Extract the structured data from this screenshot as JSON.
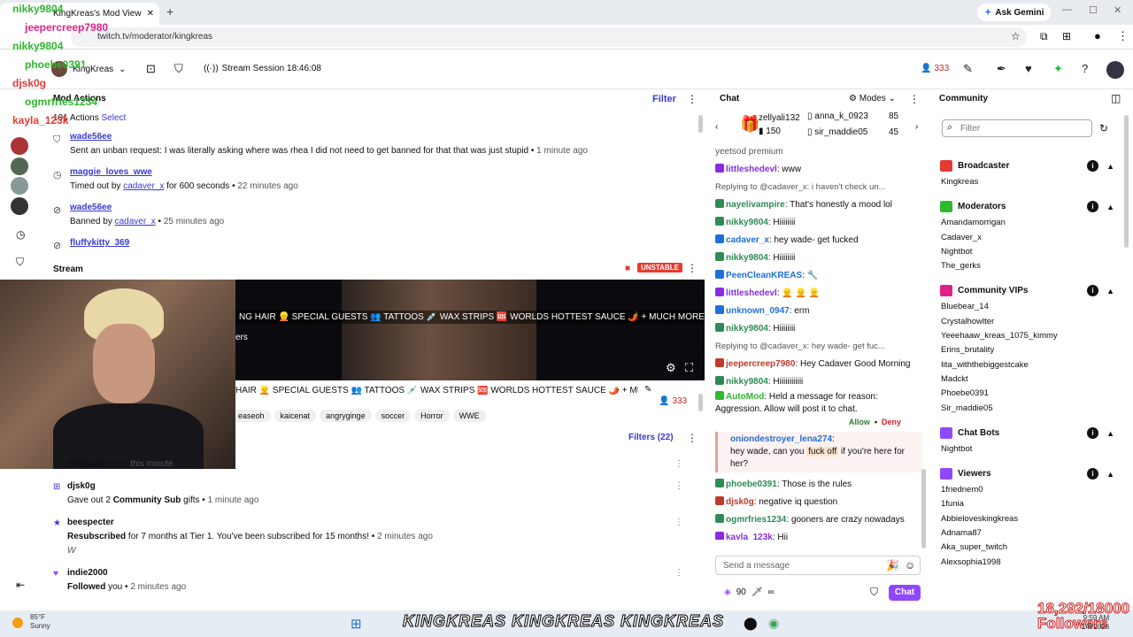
{
  "browser": {
    "tab_title": "KingKreas's Mod View - Twitch",
    "url": "twitch.tv/moderator/kingkreas",
    "ask_gemini": "Ask Gemini"
  },
  "topbar": {
    "channel": "KingKreas",
    "session": "Stream Session 18:46:08",
    "viewers": "333"
  },
  "mod_actions": {
    "title": "Mod Actions",
    "filter": "Filter",
    "count": "101 Actions",
    "select": "Select",
    "items": [
      {
        "user": "wade56ee",
        "text": "Sent an unban request: I was literally asking where was rhea I did not need to get banned for that that was just stupid",
        "time": "1 minute ago"
      },
      {
        "user": "maggie_loves_wwe",
        "pre": "Timed out by",
        "by": "cadaver_x",
        "post": "for 600 seconds",
        "time": "22 minutes ago"
      },
      {
        "user": "wade56ee",
        "pre": "Banned by",
        "by": "cadaver_x",
        "post": "",
        "time": "25 minutes ago"
      },
      {
        "user": "fluffykitty_369"
      }
    ]
  },
  "stream": {
    "title": "Stream",
    "status": "UNSTABLE",
    "marquee": "NG HAIR 👱 SPECIAL GUESTS 👥 TATTOOS 💉 WAX STRIPS 🆘 WORLDS HOTTEST SAUCE 🌶️ + MUCH MORE |",
    "marquee_sub": "ers",
    "stream_title": "HAIR 👱 SPECIAL GUESTS 👥 TATTOOS 💉 WAX STRIPS 🆘 WORLDS HOTTEST SAUCE 🌶️ + MUCH M",
    "viewers": "333",
    "tags": [
      "easeoh",
      "kaicenat",
      "angrygingе",
      "soccer",
      "Horror",
      "WWE"
    ]
  },
  "activity": {
    "filters": "Filters (22)",
    "items": [
      {
        "user": "",
        "text": "Followed",
        "mid": "you",
        "time": "this minute"
      },
      {
        "user": "djsk0g",
        "text": "Gave out 2",
        "mid": "Community Sub",
        "tail": "gifts",
        "time": "1 minute ago"
      },
      {
        "user": "beespecter",
        "text": "Resubscribed",
        "mid": "for 7 months at Tier 1. You've been subscribed for 15 months!",
        "time": "2 minutes ago",
        "note": "W"
      },
      {
        "user": "indie2000",
        "text": "Followed",
        "mid": "you",
        "time": "2 minutes ago"
      }
    ]
  },
  "chat": {
    "title": "Chat",
    "modes": "Modes",
    "gifts": [
      {
        "user": "zellyali132",
        "amount": "150"
      },
      {
        "user": "anna_k_0923",
        "amount": "85"
      },
      {
        "user": "sir_maddie05",
        "amount": "45"
      }
    ],
    "messages": [
      {
        "user": "",
        "text": "yeetsod premium",
        "color": "#555"
      },
      {
        "user": "littleshedevl",
        "text": "www",
        "color": "#8a2be2"
      },
      {
        "reply": "Replying to @cadaver_x: i haven't check un..."
      },
      {
        "user": "nayelivampire",
        "text": "That's honestly a mood lol",
        "color": "#2e8b57"
      },
      {
        "user": "nikky9804",
        "text": "Hiiiiiiii",
        "color": "#2e8b57"
      },
      {
        "user": "cadaver_x",
        "text": "hey wade- get fucked",
        "color": "#1e6fd9"
      },
      {
        "user": "nikky9804",
        "text": "Hiiiiiiii",
        "color": "#2e8b57"
      },
      {
        "user": "PeenCleanKREAS",
        "text": "🔧",
        "color": "#1e6fd9"
      },
      {
        "user": "littleshedevl",
        "text": "👱 👱 👱",
        "color": "#8a2be2"
      },
      {
        "user": "unknown_0947",
        "text": "erm",
        "color": "#1e6fd9"
      },
      {
        "user": "nikky9804",
        "text": "Hiiiiiiii",
        "color": "#2e8b57"
      },
      {
        "reply": "Replying to @cadaver_x: hey wade- get fuc..."
      },
      {
        "user": "jeepercreep7980",
        "text": "Hey Cadaver Good Morning",
        "color": "#c0392b"
      },
      {
        "user": "nikky9804",
        "text": "Hiiiiiiiiiiii",
        "color": "#2e8b57"
      }
    ],
    "automod": {
      "label": "AutoMod",
      "text": "Held a message for reason: Aggression. Allow will post it to chat.",
      "allow": "Allow",
      "deny": "Deny"
    },
    "held": {
      "user": "oniondestroyer_lena274",
      "pre": "hey wade, can you",
      "hl": "fuck off",
      "post": "if you're here for her?"
    },
    "messages2": [
      {
        "user": "phoebe0391",
        "text": "Those is the rules",
        "color": "#2e8b57"
      },
      {
        "user": "djsk0g",
        "text": "negative iq question",
        "color": "#c0392b"
      },
      {
        "user": "ogmrfries1234",
        "text": "gooners are crazy nowadays",
        "color": "#2e8b57"
      },
      {
        "user": "kayla_123k",
        "text": "Hii",
        "color": "#8a2be2"
      }
    ],
    "send_placeholder": "Send a message",
    "points": "90",
    "chat_button": "Chat"
  },
  "community": {
    "title": "Community",
    "filter_placeholder": "Filter",
    "sections": [
      {
        "name": "Broadcaster",
        "color": "#e53935",
        "users": [
          "Kingkreas"
        ]
      },
      {
        "name": "Moderators",
        "color": "#2eb82e",
        "users": [
          "Amandamorrigan",
          "Cadaver_x",
          "Nightbot",
          "The_gerks"
        ]
      },
      {
        "name": "Community VIPs",
        "color": "#e0218a",
        "users": [
          "Bluebear_14",
          "Crystalhowlter",
          "Yeeehaaw_kreas_1075_kimmy",
          "Erins_brutality",
          "Iita_withthebiggestcake",
          "Madckt",
          "Phoebe0391",
          "Sir_maddie05"
        ]
      },
      {
        "name": "Chat Bots",
        "color": "#9147ff",
        "users": [
          "Nightbot"
        ]
      },
      {
        "name": "Viewers",
        "color": "#9147ff",
        "users": [
          "1friednem0",
          "1funia",
          "Abbieloveskingkreas",
          "Adnama87",
          "Aka_super_twitch",
          "Alexsophia1998"
        ]
      }
    ]
  },
  "overlay": {
    "names": [
      {
        "n": "nikky9804",
        "c": "#2eb82e"
      },
      {
        "n": "jeepercreep7980",
        "c": "#e0218a"
      },
      {
        "n": "nikky9804",
        "c": "#2eb82e"
      },
      {
        "n": "phoebe0391",
        "c": "#2eb82e"
      },
      {
        "n": "djsk0g",
        "c": "#e53935"
      },
      {
        "n": "ogmrfries1234",
        "c": "#2eb82e"
      },
      {
        "n": "kayla_123k",
        "c": "#e53935"
      }
    ]
  },
  "taskbar": {
    "temp": "85°F",
    "weather": "Sunny",
    "ticker": "KINGKREAS  KINGKREAS  KINGKREAS",
    "followers": "18,292/18000",
    "followers_label": "Followers",
    "time": "9:59 AM",
    "date": "1/8/2026"
  }
}
